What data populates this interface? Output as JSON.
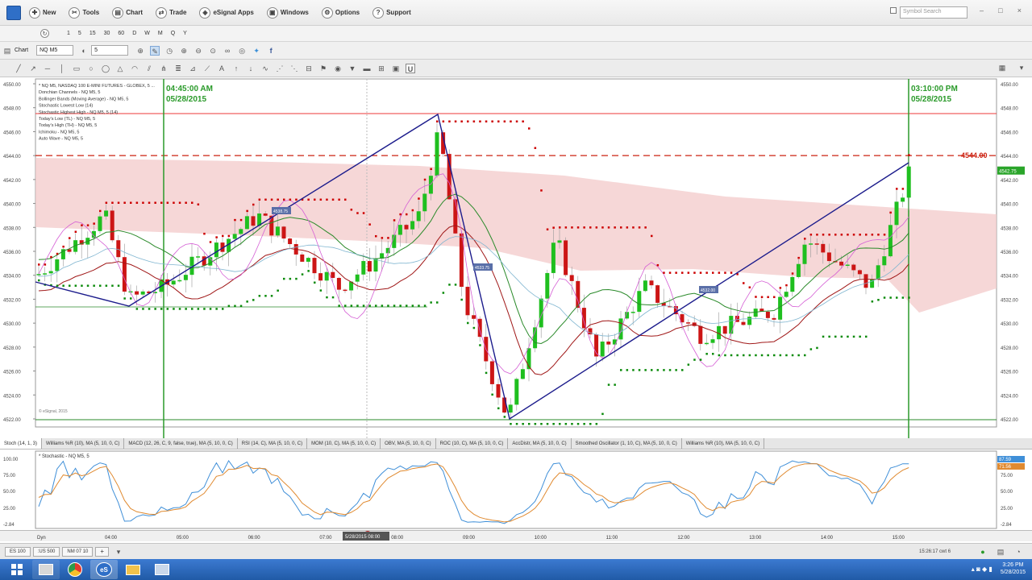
{
  "menubar": {
    "items": [
      {
        "label": "New",
        "icon": "new-doc-icon"
      },
      {
        "label": "Tools",
        "icon": "tools-icon"
      },
      {
        "label": "Chart",
        "icon": "chart-icon"
      },
      {
        "label": "Trade",
        "icon": "trade-icon"
      },
      {
        "label": "eSignal Apps",
        "icon": "apps-icon"
      },
      {
        "label": "Windows",
        "icon": "windows-icon"
      },
      {
        "label": "Options",
        "icon": "options-icon"
      },
      {
        "label": "Support",
        "icon": "support-icon"
      }
    ],
    "symbol_search_placeholder": "Symbol Search"
  },
  "intervals": [
    "1",
    "5",
    "15",
    "30",
    "60",
    "D",
    "W",
    "M",
    "Q",
    "Y"
  ],
  "chartbar": {
    "title": "Chart",
    "symbol": "NQ M5",
    "interval": "5"
  },
  "chart": {
    "info_lines": [
      "* NQ M5, NASDAQ 100 E-MINI FUTURES - GLOBEX, 5 ...",
      "Donchian Channels - NQ M5, 5",
      "Bollinger Bands (Moving Average) - NQ M5, 5",
      "Stochastic Lowest Low (14)",
      "Stochastic Highest High - NQ M5, 5 (14)",
      "Today's Low (TL) - NQ M5, 5",
      "Today's High (TH) - NQ M5, 5",
      "Ichimoku - NQ M5, 5",
      "Auto Wave - NQ M5, 5"
    ],
    "left_marker": {
      "time": "04:45:00 AM",
      "date": "05/28/2015"
    },
    "right_marker": {
      "time": "03:10:00 PM",
      "date": "05/28/2015"
    },
    "price_line_label": "4544.00",
    "last_price": "4542.75",
    "copyright": "© eSignal, 2015",
    "price_axis": [
      "4550.00",
      "4548.00",
      "4546.00",
      "4544.00",
      "4542.00",
      "4540.00",
      "4538.00",
      "4536.00",
      "4534.00",
      "4532.00",
      "4530.00",
      "4528.00",
      "4526.00",
      "4524.00",
      "4522.00"
    ],
    "wave_labels": [
      "4538.75",
      "4533.75",
      "4532.00"
    ]
  },
  "indicator_tabs": [
    "Stoch (14, 1, 3)",
    "Williams %R (10), MA (5, 10, 0, C)",
    "MACD (12, 26, C, 9, false, true), MA (5, 10, 0, C)",
    "RSI (14, C), MA (5, 10, 0, C)",
    "MOM (10, C), MA (5, 10, 0, C)",
    "OBV, MA (5, 10, 0, C)",
    "ROC (10, C), MA (5, 10, 0, C)",
    "AccDistr, MA (5, 10, 0, C)",
    "Smoothed Oscillator (1, 10, C), MA (5, 10, 0, C)",
    "Williams %R (10), MA (5, 10, 0, C)"
  ],
  "oscillator": {
    "title": "* Stochastic - NQ M5, 5",
    "axis": [
      "100.00",
      "75.00",
      "50.00",
      "25.00",
      "-2.84"
    ],
    "value_a": "87.59",
    "value_b": "71.56"
  },
  "time_axis": {
    "ticks": [
      "04:00",
      "05:00",
      "06:00",
      "07:00",
      "08:00",
      "09:00",
      "10:00",
      "11:00",
      "12:00",
      "13:00",
      "14:00",
      "15:00"
    ],
    "cursor_label": "5/28/2015 08:00",
    "dyn_label": "Dyn"
  },
  "symbol_tabs": [
    "ES 100",
    ":US 500",
    "NM 07 10"
  ],
  "statusbar": {
    "time": "15:26:17 cwt 6"
  },
  "taskbar": {
    "time": "3:26 PM",
    "date": "5/28/2015"
  },
  "colors": {
    "up": "#1fbf1f",
    "down": "#cc1515",
    "wave": "#1c1c8c",
    "accent_green": "#2a9a2a"
  }
}
